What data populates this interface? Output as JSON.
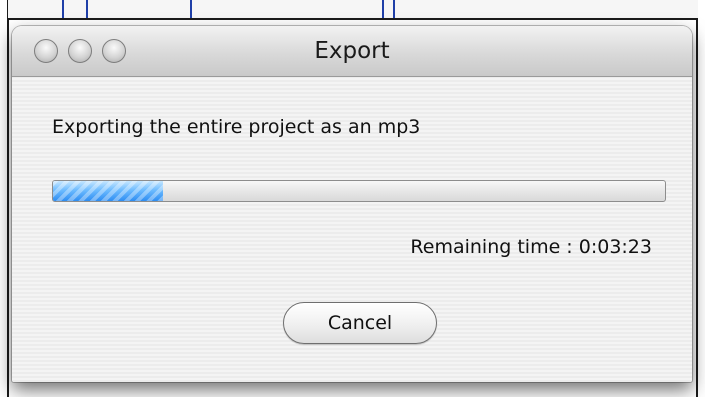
{
  "dialog": {
    "title": "Export",
    "message": "Exporting the entire project as an mp3",
    "progress": {
      "fraction": 0.18,
      "accent_color": "#2d8df2"
    },
    "remaining_time_label": "Remaining time : 0:03:23",
    "cancel_label": "Cancel"
  },
  "window_controls": {
    "close_icon": "close-icon",
    "minimize_icon": "minimize-icon",
    "zoom_icon": "zoom-icon"
  }
}
